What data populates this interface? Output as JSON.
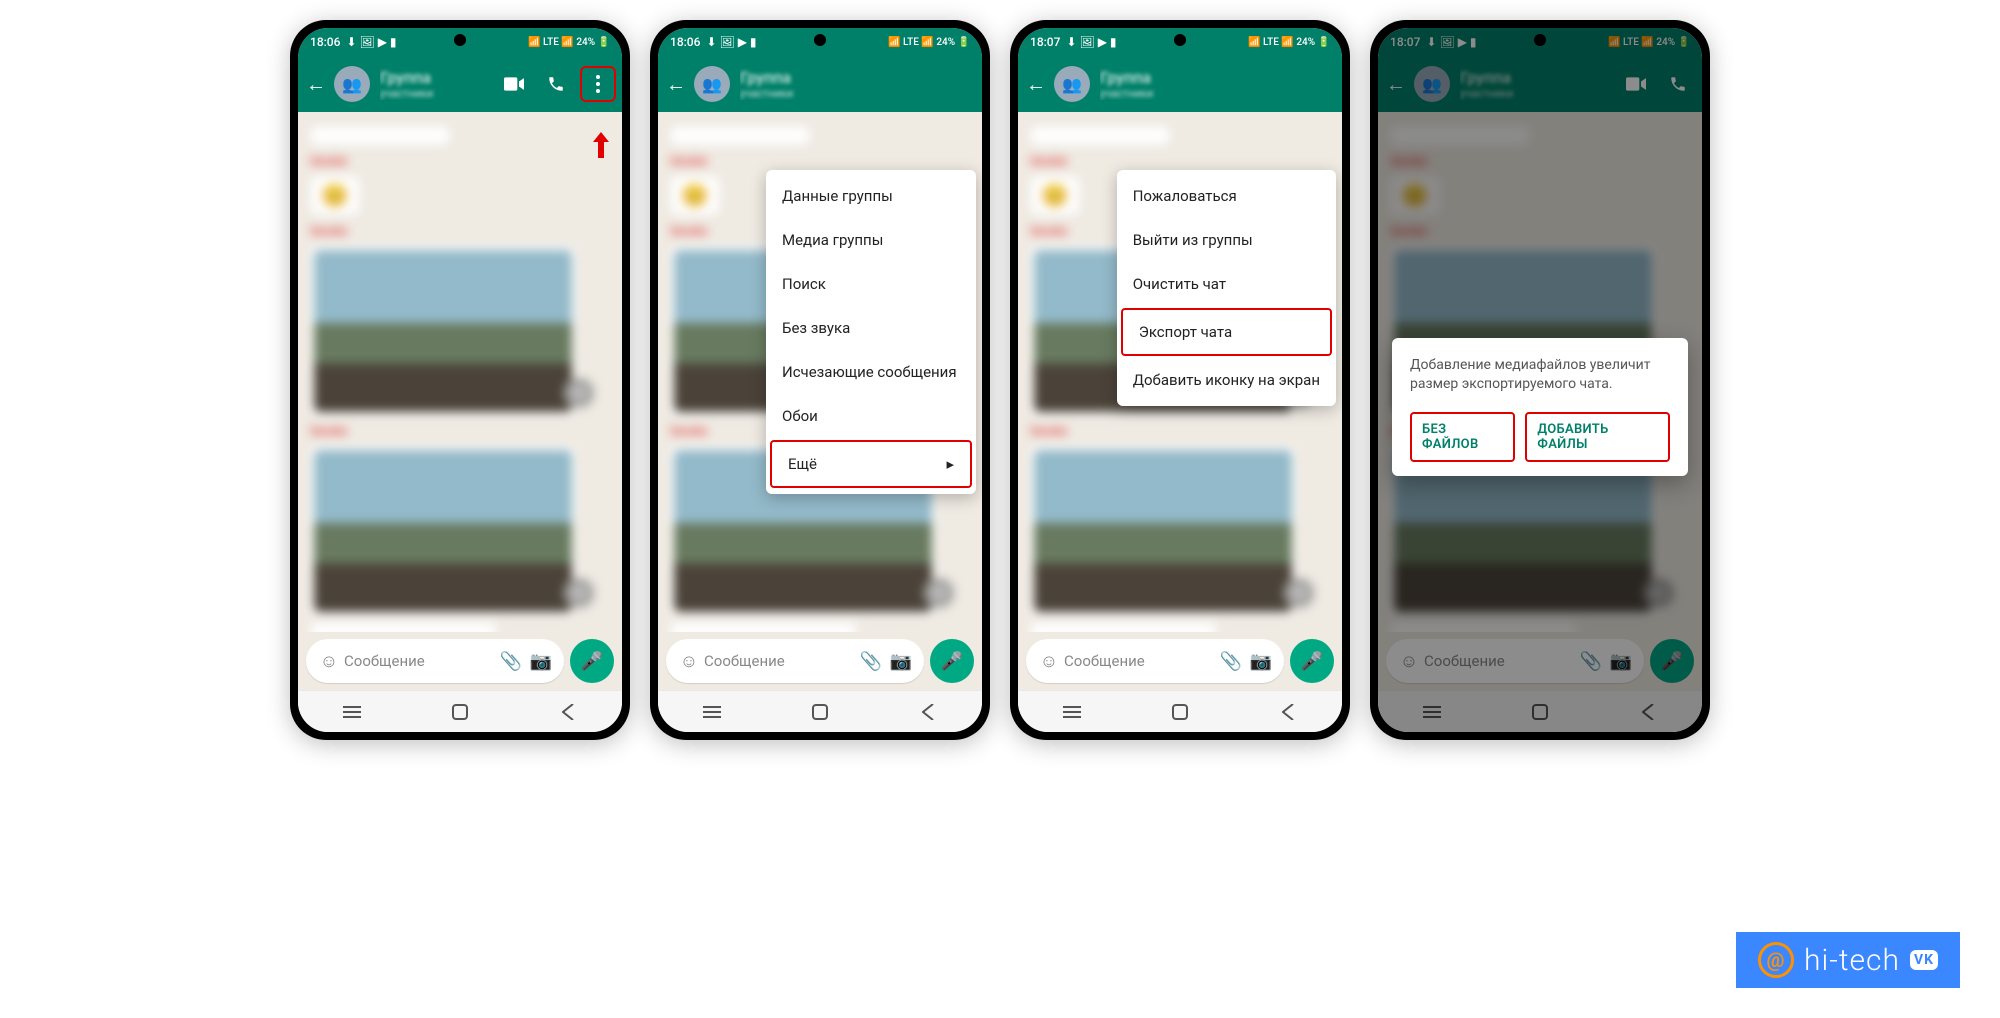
{
  "status": {
    "time1": "18:06",
    "time2": "18:06",
    "time3": "18:07",
    "time4": "18:07",
    "left_icons": "⬇ 🖼 ▶ ▮",
    "right_icons": "📶 LTE 📶 24% 🔋",
    "battery": "24%"
  },
  "header": {
    "title": "Группа",
    "subtitle": "участники"
  },
  "input": {
    "placeholder": "Сообщение"
  },
  "menu1": {
    "items": [
      {
        "label": "Данные группы"
      },
      {
        "label": "Медиа группы"
      },
      {
        "label": "Поиск"
      },
      {
        "label": "Без звука"
      },
      {
        "label": "Исчезающие сообщения"
      },
      {
        "label": "Обои"
      },
      {
        "label": "Ещё",
        "has_arrow": true,
        "highlight": true
      }
    ]
  },
  "menu2": {
    "items": [
      {
        "label": "Пожаловаться"
      },
      {
        "label": "Выйти из группы"
      },
      {
        "label": "Очистить чат"
      },
      {
        "label": "Экспорт чата",
        "highlight": true
      },
      {
        "label": "Добавить иконку на экран"
      }
    ]
  },
  "dialog": {
    "text": "Добавление медиафайлов увеличит размер экспортируемого чата.",
    "btn_no": "БЕЗ ФАЙЛОВ",
    "btn_yes": "ДОБАВИТЬ ФАЙЛЫ"
  },
  "watermark": {
    "brand": "hi-tech"
  }
}
